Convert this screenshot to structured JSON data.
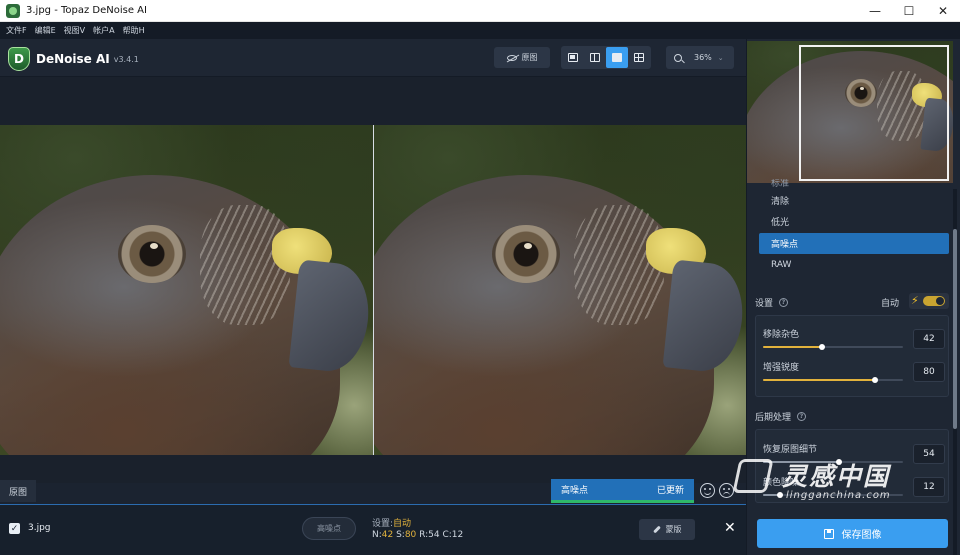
{
  "window": {
    "title": "3.jpg - Topaz DeNoise AI",
    "controls": {
      "minimize": "—",
      "maximize": "☐",
      "close": "✕"
    }
  },
  "menu": [
    {
      "label": "文件F"
    },
    {
      "label": "编辑E"
    },
    {
      "label": "视图V"
    },
    {
      "label": "帐户A"
    },
    {
      "label": "帮助H"
    }
  ],
  "toolbar": {
    "app_name": "DeNoise AI",
    "version": "v3.4.1",
    "logo_letter": "D",
    "original_button": "原图",
    "view_modes": [
      "single",
      "split",
      "side-by-side",
      "grid"
    ],
    "active_view_mode": "side-by-side",
    "zoom": "36%"
  },
  "canvas": {
    "original_label": "原图"
  },
  "model_popup": {
    "model": "高噪点",
    "status": "已更新"
  },
  "file_bar": {
    "checkbox": "✓",
    "filename": "3.jpg",
    "model_pill": "高噪点",
    "settings_prefix": "设置:",
    "settings_value": "自动",
    "stats": {
      "N": "42",
      "S": "80",
      "R": "54",
      "C": "12"
    },
    "mask_button": "蒙版",
    "close": "✕"
  },
  "panel": {
    "models": [
      {
        "label": "标准",
        "state": "cut"
      },
      {
        "label": "清除",
        "state": "normal"
      },
      {
        "label": "低光",
        "state": "normal"
      },
      {
        "label": "高噪点",
        "state": "selected"
      },
      {
        "label": "RAW",
        "state": "normal"
      }
    ],
    "settings_title": "设置",
    "auto_label": "自动",
    "auto_on": true,
    "sliders": [
      {
        "label": "移除杂色",
        "value": "42",
        "fraction": 0.42
      },
      {
        "label": "增强锐度",
        "value": "80",
        "fraction": 0.8
      }
    ],
    "post_title": "后期处理",
    "post_sliders": [
      {
        "label": "恢复原图细节",
        "value": "54",
        "fraction": 0.54
      },
      {
        "label": "颜色降噪",
        "value": "12",
        "fraction": 0.12
      }
    ],
    "save_button": "保存图像"
  },
  "watermark": {
    "text": "灵感中国",
    "url": "lingganchina.com"
  },
  "colors": {
    "accent": "#3a9ef0",
    "selected": "#2270b8",
    "highlight": "#e2b23c",
    "success": "#2fb86a"
  }
}
